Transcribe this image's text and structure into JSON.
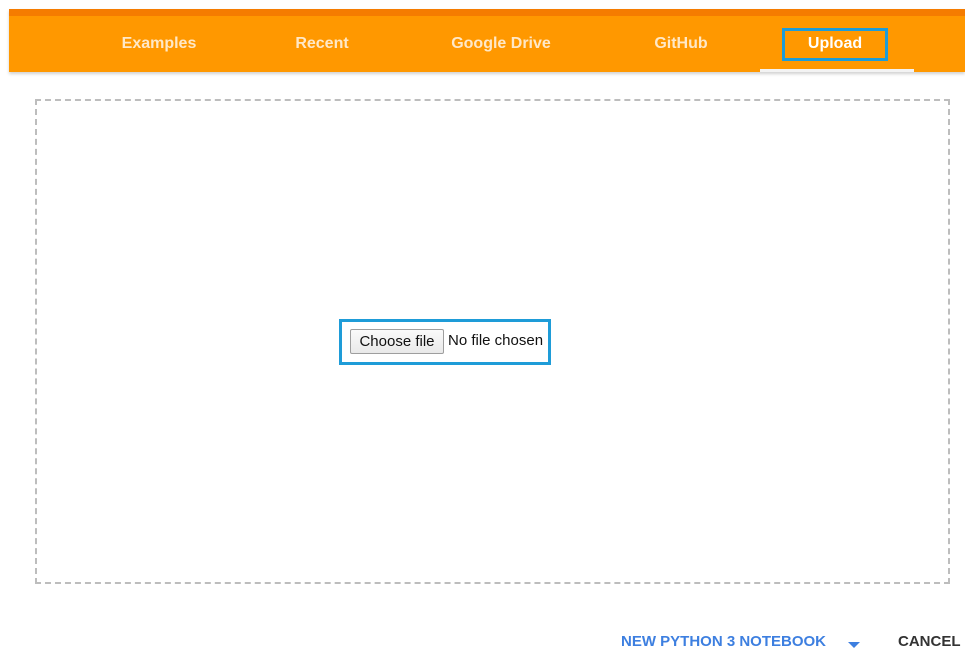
{
  "tabs": [
    {
      "label": "Examples"
    },
    {
      "label": "Recent"
    },
    {
      "label": "Google Drive"
    },
    {
      "label": "GitHub"
    },
    {
      "label": "Upload",
      "active": true
    }
  ],
  "upload": {
    "choose_file_label": "Choose file",
    "file_status": "No file chosen"
  },
  "footer": {
    "new_notebook_label": "NEW PYTHON 3 NOTEBOOK",
    "dropdown_icon": "chevron-down-icon",
    "cancel_label": "CANCEL"
  },
  "colors": {
    "tab_bar": "#ff9800",
    "tab_bar_top": "#f57c00",
    "highlight": "#1e9cd8",
    "primary_action": "#3d7fe0",
    "cancel_action": "#333333"
  }
}
